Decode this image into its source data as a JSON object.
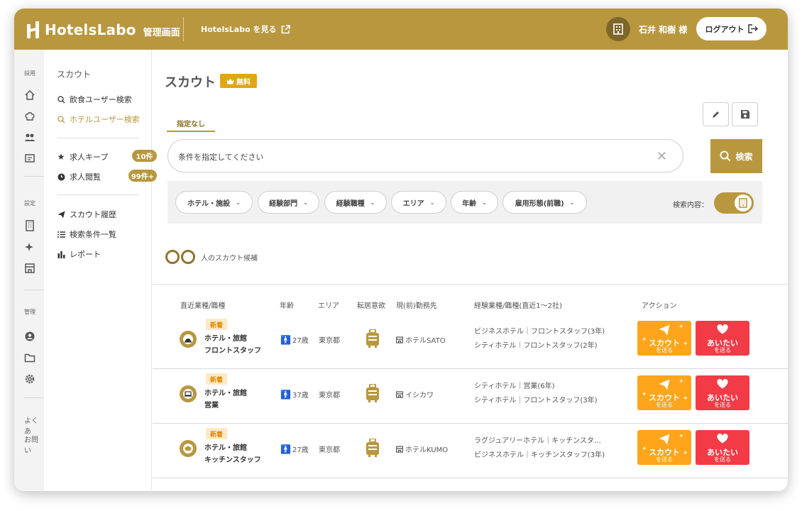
{
  "header": {
    "brand": "HotelsLabo",
    "brand_sub": "管理画面",
    "site_link": "HotelsLabo を見る",
    "user_name": "石井 和樹 様",
    "logout_label": "ログアウト"
  },
  "rail": {
    "section_recruit": "採用",
    "section_settings": "設定",
    "section_admin": "管理",
    "faq": "よくあ",
    "contact": "お問い"
  },
  "subnav": {
    "title": "スカウト",
    "search_food_users": "飲食ユーザー検索",
    "search_hotel_users": "ホテルユーザー検索",
    "job_keep": "求人キープ",
    "job_keep_count": "10件",
    "job_views": "求人閲覧",
    "job_views_count": "99件+",
    "scout_history": "スカウト履歴",
    "saved_searches": "検索条件一覧",
    "report": "レポート"
  },
  "main": {
    "title": "スカウト",
    "free_badge": "無料",
    "tab_label": "指定なし",
    "search_placeholder": "条件を指定してください",
    "search_button": "検索",
    "filters": [
      "ホテル・施設",
      "経験部門",
      "経験職種",
      "エリア",
      "年齢",
      "雇用形態(前職)"
    ],
    "filter_toggle_label": "検索内容：",
    "candidate_count_suffix": "人のスカウト候補"
  },
  "table": {
    "headers": [
      "直近業種/職種",
      "年齢",
      "エリア",
      "転居意欲",
      "現(前)勤務先",
      "経験業種/職種(直近1〜2社)",
      "アクション"
    ],
    "rows": [
      {
        "badge": "新着",
        "industry": "ホテル・旅館",
        "role": "フロントスタッフ",
        "age": "27歳",
        "area": "東京都",
        "workplace": "ホテルSATO",
        "exp1": "ビジネスホテル｜フロントスタッフ(3年)",
        "exp2": "シティホテル｜フロントスタッフ(2年)"
      },
      {
        "badge": "新着",
        "industry": "ホテル・旅館",
        "role": "営業",
        "age": "37歳",
        "area": "東京都",
        "workplace": "イシカワ",
        "exp1": "シティホテル｜営業(6年)",
        "exp2": "シティホテル｜フロントスタッフ(3年)"
      },
      {
        "badge": "新着",
        "industry": "ホテル・旅館",
        "role": "キッチンスタッフ",
        "age": "27歳",
        "area": "東京都",
        "workplace": "ホテルKUMO",
        "exp1": "ラグジュアリーホテル｜キッチンスタ…",
        "exp2": "ビジネスホテル｜キッチンスタッフ(3年)"
      }
    ],
    "scout_button": "スカウト",
    "scout_button_sub": "を送る",
    "aitai_button": "あいたい",
    "aitai_button_sub": "を送る"
  },
  "colors": {
    "brand": "#b8973f",
    "free_badge": "#e0a617",
    "scout": "#ffa51c",
    "aitai": "#f23b47",
    "new_badge_bg": "#fde8c7",
    "age_icon": "#1aa3d9"
  }
}
